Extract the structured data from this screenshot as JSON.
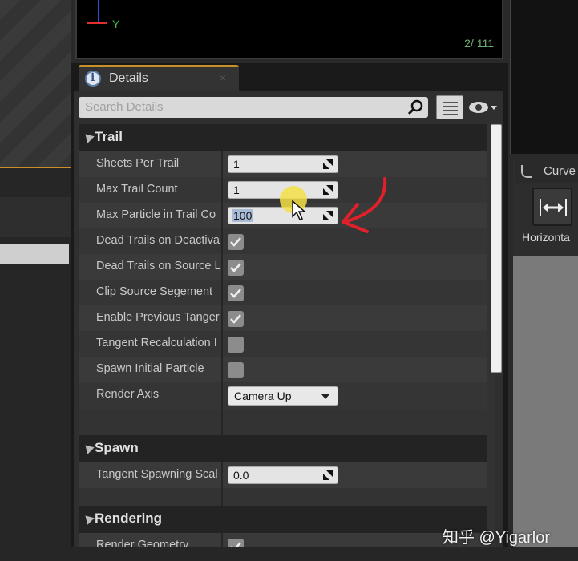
{
  "viewport": {
    "axis_label": "Y",
    "frame_counter": "2/ 111"
  },
  "details_tab": {
    "title": "Details",
    "close": "×"
  },
  "search": {
    "placeholder": "Search Details"
  },
  "categories": {
    "trail": "Trail",
    "spawn": "Spawn",
    "rendering": "Rendering"
  },
  "trail_props": {
    "sheets_per_trail": {
      "label": "Sheets Per Trail",
      "value": "1"
    },
    "max_trail_count": {
      "label": "Max Trail Count",
      "value": "1"
    },
    "max_particle_in_trail": {
      "label": "Max Particle in Trail Co",
      "value": "100"
    },
    "dead_trails_on_deactivate": {
      "label": "Dead Trails on Deactiva",
      "checked": true
    },
    "dead_trails_on_source_loss": {
      "label": "Dead Trails on Source L",
      "checked": true
    },
    "clip_source_segment": {
      "label": "Clip Source Segement",
      "checked": true
    },
    "enable_previous_tangent": {
      "label": "Enable Previous Tanger",
      "checked": true
    },
    "tangent_recalculation": {
      "label": "Tangent Recalculation I",
      "checked": false
    },
    "spawn_initial_particle": {
      "label": "Spawn Initial Particle",
      "checked": false
    },
    "render_axis": {
      "label": "Render Axis",
      "value": "Camera Up"
    }
  },
  "spawn_props": {
    "tangent_spawning_scale": {
      "label": "Tangent Spawning Scal",
      "value": "0.0"
    }
  },
  "rendering_props": {
    "render_geometry": {
      "label": "Render Geometry",
      "checked": true
    }
  },
  "right_panel": {
    "tab_label": "Curve",
    "button_label": "Horizonta"
  },
  "watermark": "知乎 @Yigarlor",
  "colors": {
    "accent_orange": "#c9902a",
    "annotation_red": "#e0202a",
    "cursor_highlight": "#f5e146"
  },
  "icons": [
    "info-icon",
    "search-icon",
    "list-view-icon",
    "eye-icon",
    "chevron-down-icon",
    "curve-icon",
    "horizontal-arrows-icon",
    "mouse-cursor-icon"
  ]
}
